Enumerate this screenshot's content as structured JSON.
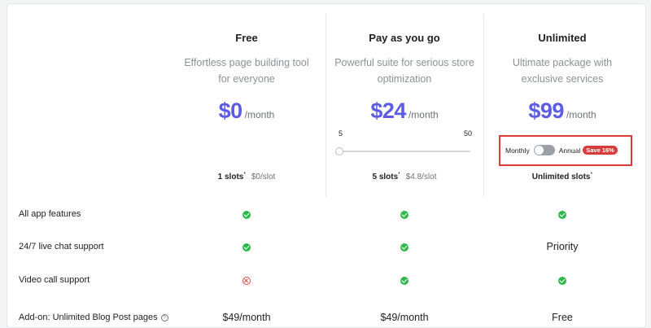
{
  "plans": [
    {
      "name": "Free",
      "desc_line1": "Effortless page building tool",
      "desc_line2": "for everyone",
      "price": "$0",
      "period": "/month",
      "slots": "1 slots",
      "slots_mark": "*",
      "slot_price": "$0/slot"
    },
    {
      "name": "Pay as you go",
      "desc_line1": "Powerful suite for serious store",
      "desc_line2": "optimization",
      "price": "$24",
      "period": "/month",
      "slider_min": "5",
      "slider_max": "50",
      "slider_value": 5,
      "slots": "5 slots",
      "slots_mark": "*",
      "slot_price": "$4.8/slot"
    },
    {
      "name": "Unlimited",
      "desc_line1": "Ultimate package with",
      "desc_line2": "exclusive services",
      "price": "$99",
      "period": "/month",
      "billing": {
        "monthly_label": "Monthly",
        "annual_label": "Annual",
        "save_badge": "Save 16%",
        "annual_selected": false
      },
      "slots": "Unlimited slots",
      "slots_mark": "*"
    }
  ],
  "features": [
    {
      "label": "All app features",
      "values": [
        "check",
        "check",
        "check"
      ]
    },
    {
      "label": "24/7 live chat support",
      "values": [
        "check",
        "check",
        "Priority"
      ]
    },
    {
      "label": "Video call support",
      "values": [
        "cross",
        "check",
        "check"
      ]
    },
    {
      "label": "Add-on: Unlimited Blog Post pages",
      "help": "?",
      "values": [
        "$49/month",
        "$49/month",
        "Free"
      ]
    }
  ],
  "colors": {
    "price": "#5b5ce2",
    "check": "#2fb84a",
    "cross": "#e04646",
    "highlight_border": "#d93b3b"
  }
}
